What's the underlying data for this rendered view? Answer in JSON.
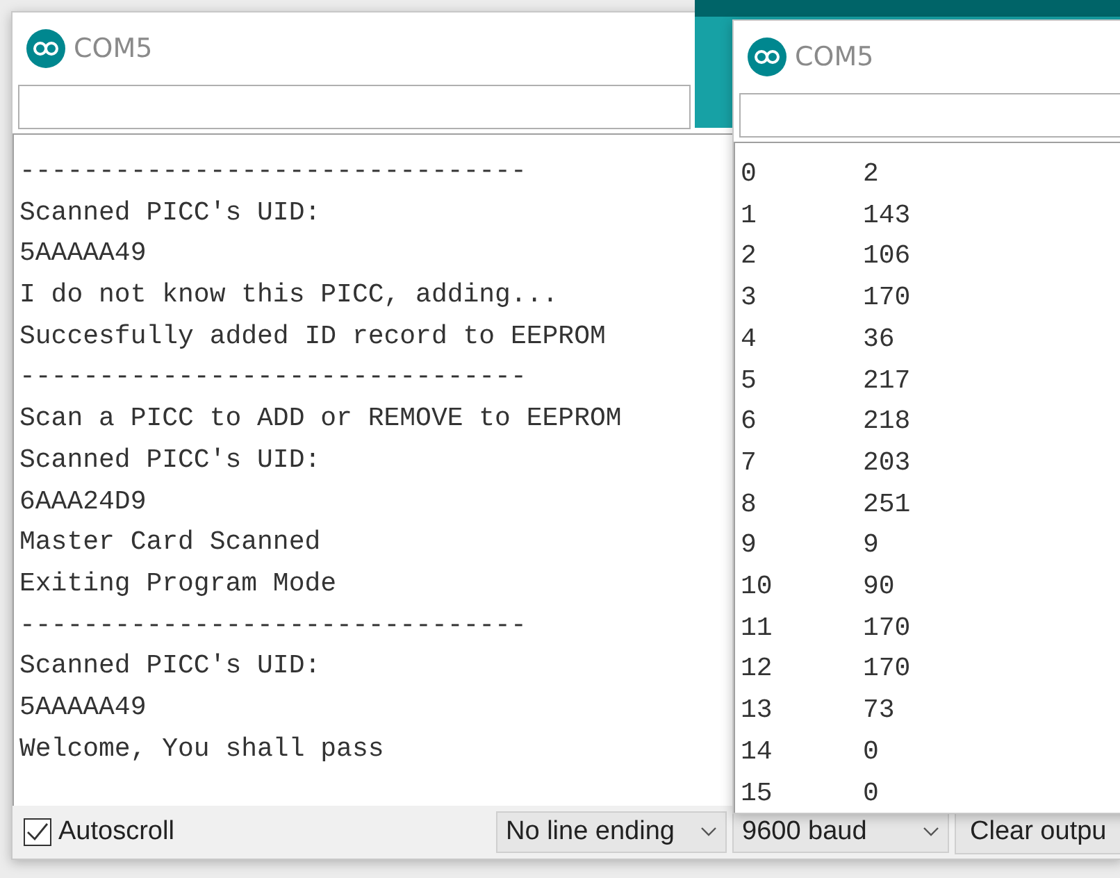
{
  "windows": [
    {
      "title": "COM5",
      "lines": [
        "--------------------------------",
        "Scanned PICC's UID:",
        "5AAAAA49",
        "I do not know this PICC, adding...",
        "Succesfully added ID record to EEPROM",
        "--------------------------------",
        "Scan a PICC to ADD or REMOVE to EEPROM",
        "Scanned PICC's UID:",
        "6AAA24D9",
        "Master Card Scanned",
        "Exiting Program Mode",
        "--------------------------------",
        "Scanned PICC's UID:",
        "5AAAAA49",
        "Welcome, You shall pass"
      ],
      "autoscroll": {
        "label": "Autoscroll",
        "checked": true
      },
      "line_ending": "No line ending",
      "baud": "9600 baud",
      "clear_button": "Clear outpu"
    },
    {
      "title": "COM5",
      "rows": [
        {
          "index": "0",
          "value": "2"
        },
        {
          "index": "1",
          "value": "143"
        },
        {
          "index": "2",
          "value": "106"
        },
        {
          "index": "3",
          "value": "170"
        },
        {
          "index": "4",
          "value": "36"
        },
        {
          "index": "5",
          "value": "217"
        },
        {
          "index": "6",
          "value": "218"
        },
        {
          "index": "7",
          "value": "203"
        },
        {
          "index": "8",
          "value": "251"
        },
        {
          "index": "9",
          "value": "9"
        },
        {
          "index": "10",
          "value": "90"
        },
        {
          "index": "11",
          "value": "170"
        },
        {
          "index": "12",
          "value": "170"
        },
        {
          "index": "13",
          "value": "73"
        },
        {
          "index": "14",
          "value": "0"
        },
        {
          "index": "15",
          "value": "0"
        }
      ]
    }
  ]
}
